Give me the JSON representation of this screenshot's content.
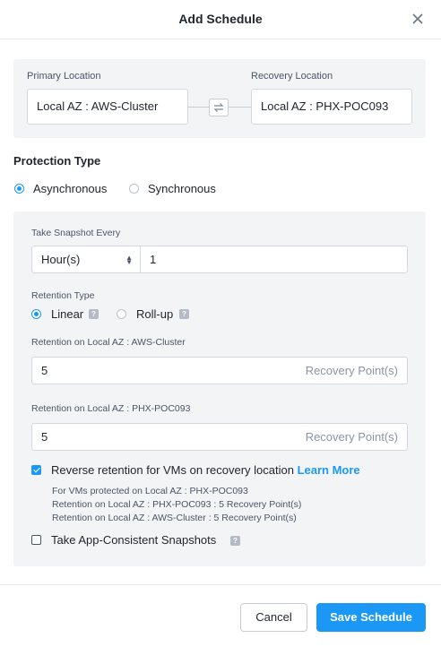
{
  "dialog": {
    "title": "Add Schedule"
  },
  "locations": {
    "primary_label": "Primary Location",
    "primary_value": "Local AZ : AWS-Cluster",
    "recovery_label": "Recovery Location",
    "recovery_value": "Local AZ : PHX-POC093"
  },
  "protection": {
    "title": "Protection Type",
    "options": [
      {
        "label": "Asynchronous",
        "selected": true
      },
      {
        "label": "Synchronous",
        "selected": false
      }
    ]
  },
  "schedule": {
    "snapshot_label": "Take Snapshot Every",
    "interval_unit": "Hour(s)",
    "interval_value": "1",
    "retention_type_label": "Retention Type",
    "retention_types": [
      {
        "label": "Linear",
        "selected": true
      },
      {
        "label": "Roll-up",
        "selected": false
      }
    ],
    "retention_local_label": "Retention on Local AZ : AWS-Cluster",
    "retention_local_value": "5",
    "retention_remote_label": "Retention on Local AZ : PHX-POC093",
    "retention_remote_value": "5",
    "unit_suffix": "Recovery Point(s)",
    "reverse_retention_label": "Reverse retention for VMs on recovery location",
    "reverse_retention_checked": true,
    "learn_more": "Learn More",
    "notes": [
      "For VMs protected on Local AZ : PHX-POC093",
      "Retention on Local AZ : PHX-POC093 : 5 Recovery Point(s)",
      "Retention on Local AZ : AWS-Cluster : 5 Recovery Point(s)"
    ],
    "app_consistent_label": "Take App-Consistent Snapshots",
    "app_consistent_checked": false,
    "help_glyph": "?"
  },
  "footer": {
    "cancel_label": "Cancel",
    "save_label": "Save Schedule"
  },
  "colors": {
    "accent": "#1b98f5",
    "panel": "#f2f4f6"
  },
  "icons": {
    "close": "close-icon",
    "swap": "swap-icon",
    "help": "help-icon",
    "select_arrows": "select-arrows-icon"
  }
}
